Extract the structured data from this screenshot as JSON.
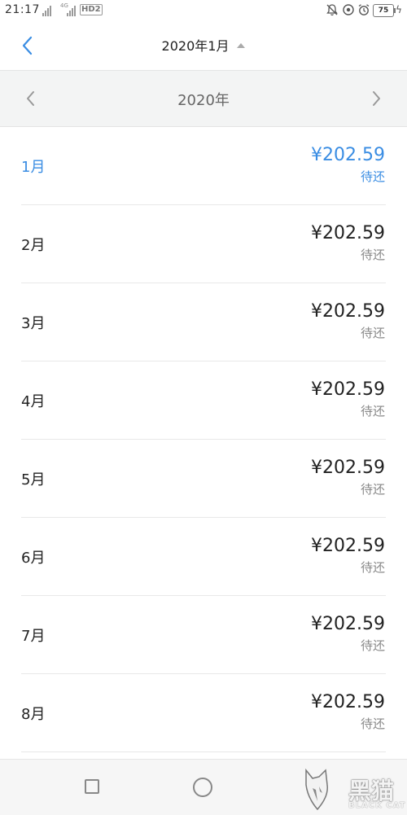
{
  "status_bar": {
    "time": "21:17",
    "network_type": "4G",
    "hd_label": "HD2",
    "battery_level": "75",
    "icons": [
      "bell-muted-icon",
      "clock-circle-icon",
      "alarm-icon",
      "charging-bolt-icon"
    ]
  },
  "nav": {
    "title": "2020年1月",
    "back_icon": "chevron-left-icon",
    "dropdown_icon": "caret-up-icon"
  },
  "year_selector": {
    "year": "2020年",
    "prev_icon": "chevron-left-icon",
    "next_icon": "chevron-right-icon"
  },
  "months": [
    {
      "month": "1月",
      "amount": "¥202.59",
      "status": "待还",
      "selected": true
    },
    {
      "month": "2月",
      "amount": "¥202.59",
      "status": "待还",
      "selected": false
    },
    {
      "month": "3月",
      "amount": "¥202.59",
      "status": "待还",
      "selected": false
    },
    {
      "month": "4月",
      "amount": "¥202.59",
      "status": "待还",
      "selected": false
    },
    {
      "month": "5月",
      "amount": "¥202.59",
      "status": "待还",
      "selected": false
    },
    {
      "month": "6月",
      "amount": "¥202.59",
      "status": "待还",
      "selected": false
    },
    {
      "month": "7月",
      "amount": "¥202.59",
      "status": "待还",
      "selected": false
    },
    {
      "month": "8月",
      "amount": "¥202.59",
      "status": "待还",
      "selected": false
    }
  ],
  "colors": {
    "accent": "#3a8de3",
    "year_bar_bg": "#f3f4f4",
    "divider": "#e8e8e8"
  },
  "watermark": {
    "name_cn": "黑猫",
    "name_en": "BLACK CAT"
  }
}
